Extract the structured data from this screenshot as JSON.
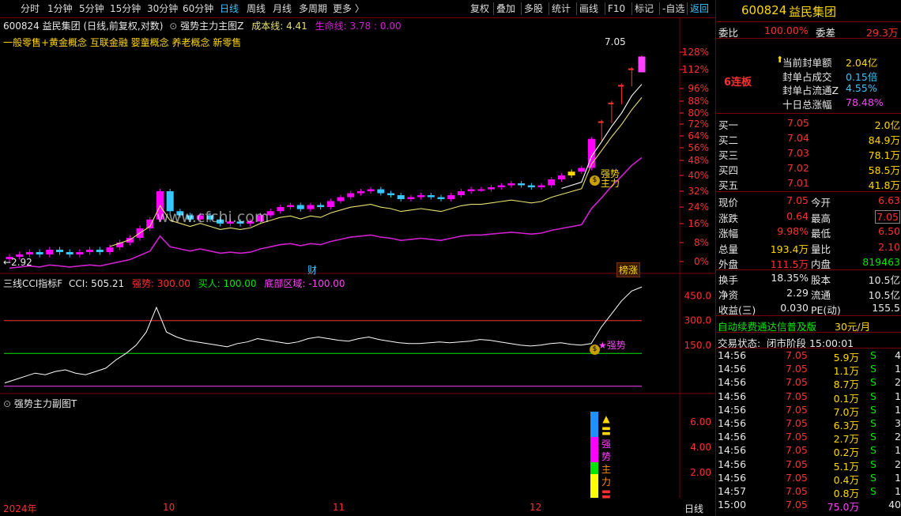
{
  "toolbar": {
    "left": [
      {
        "label": "分时",
        "active": false
      },
      {
        "label": "1分钟",
        "active": false
      },
      {
        "label": "5分钟",
        "active": false
      },
      {
        "label": "15分钟",
        "active": false
      },
      {
        "label": "30分钟",
        "active": false
      },
      {
        "label": "60分钟",
        "active": false
      },
      {
        "label": "日线",
        "active": true
      },
      {
        "label": "周线",
        "active": false
      },
      {
        "label": "月线",
        "active": false
      },
      {
        "label": "多周期",
        "active": false
      },
      {
        "label": "更多 〉",
        "active": false
      }
    ],
    "right": [
      {
        "label": "复权",
        "active": false
      },
      {
        "label": "叠加",
        "active": false
      },
      {
        "label": "多股",
        "active": false
      },
      {
        "label": "统计",
        "active": false
      },
      {
        "label": "画线",
        "active": false
      },
      {
        "label": "F10",
        "active": false
      },
      {
        "label": "标记",
        "active": false
      },
      {
        "label": "-自选",
        "active": false
      },
      {
        "label": "返回",
        "active": true
      }
    ]
  },
  "main_chart": {
    "stock_line": "600824 益民集团 (日线,前复权,对数)",
    "indicator_name": "强势主力主图Z",
    "cost_line": "成本线: 4.41",
    "life_line": "生命线: 3.78 : 0.00",
    "concepts": "一般零售+黄金概念 互联金融 婴童概念 养老概念 新零售",
    "high_label": "7.05",
    "low_label": "←2.92",
    "tag_cai": "财",
    "tag_bangzhang": "榜涨",
    "signal_line1": "强势",
    "signal_line2": "主力",
    "watermark": "www.cfchi.com"
  },
  "chart_data": [
    {
      "type": "candlestick",
      "title": "600824 益民集团 (日线,前复权,对数)",
      "yscale": "log",
      "y_ticks": [
        "128%",
        "112%",
        "96%",
        "88%",
        "80%",
        "72%",
        "64%",
        "56%",
        "48%",
        "40%",
        "32%",
        "24%",
        "16%",
        "8%",
        "0%"
      ],
      "low_label": "2.92",
      "high_label": "7.05",
      "series": [
        {
          "name": "成本线",
          "color": "#e8e070",
          "last": 4.41
        },
        {
          "name": "生命线",
          "color": "#d020d0",
          "last": 3.78
        }
      ],
      "approx_closes_pct": [
        2,
        3,
        4,
        3,
        5,
        4,
        3,
        4,
        5,
        4,
        6,
        8,
        10,
        14,
        18,
        32,
        22,
        20,
        18,
        20,
        18,
        16,
        17,
        16,
        17,
        20,
        22,
        24,
        25,
        23,
        25,
        24,
        27,
        29,
        31,
        32,
        33,
        31,
        30,
        28,
        29,
        30,
        29,
        28,
        30,
        32,
        33,
        33,
        34,
        35,
        36,
        35,
        34,
        35,
        38,
        40,
        42,
        44,
        62,
        74,
        87,
        99,
        113,
        124
      ],
      "dates": [
        "2024年",
        "10",
        "11",
        "12"
      ]
    },
    {
      "type": "line",
      "title": "三线CCI指标F",
      "legend": [
        {
          "label": "CCI: 505.21",
          "color": "#ffffff"
        },
        {
          "label": "强势: 300.00",
          "color": "#ff3030"
        },
        {
          "label": "买人: 100.00",
          "color": "#00e600"
        },
        {
          "label": "底部区域: -100.00",
          "color": "#ff40ff"
        }
      ],
      "y_ticks": [
        "450.0",
        "300.0",
        "150.0"
      ],
      "reference_lines": [
        300,
        100,
        -100
      ],
      "cci_values": [
        -80,
        -60,
        -40,
        -20,
        -30,
        -10,
        0,
        -20,
        -30,
        -10,
        10,
        60,
        100,
        150,
        230,
        380,
        230,
        200,
        180,
        170,
        160,
        150,
        140,
        160,
        170,
        190,
        180,
        170,
        160,
        170,
        190,
        200,
        190,
        180,
        175,
        190,
        200,
        185,
        175,
        165,
        160,
        160,
        165,
        170,
        165,
        170,
        175,
        185,
        180,
        170,
        160,
        150,
        145,
        150,
        160,
        165,
        155,
        150,
        160,
        260,
        340,
        420,
        480,
        505
      ]
    },
    {
      "type": "bar",
      "title": "强势主力副图T",
      "y_ticks": [
        "6.00",
        "4.00",
        "2.00"
      ],
      "legend_vertical": [
        "▲",
        "〓",
        "强",
        "势",
        "主",
        "力",
        "〓"
      ]
    }
  ],
  "cci_panel": {
    "title": "三线CCI指标F",
    "cci_value": "CCI: 505.21",
    "strong": "强势: 300.00",
    "buy": "买人: 100.00",
    "bottom": "底部区域: -100.00",
    "signal": "★强势"
  },
  "sub_panel": {
    "title": "强势主力副图T",
    "vlabels": [
      "▲",
      "〓",
      "强",
      "势",
      "主",
      "力",
      "〓"
    ]
  },
  "date_axis": {
    "labels": [
      "2024年",
      "10",
      "11",
      "12"
    ],
    "period": "日线"
  },
  "quote": {
    "code": "600824",
    "name": "益民集团",
    "webi_label": "委比",
    "webi_value": "100.00%",
    "weicha_label": "委差",
    "weicha_value": "29.3万",
    "board": "6连板",
    "seal": [
      {
        "label": "当前封单额",
        "value": "2.04亿",
        "color": "yellow",
        "arrow": "⬆"
      },
      {
        "label": "封单占成交",
        "value": "0.15倍",
        "color": "cyan",
        "arrow": ""
      },
      {
        "label": "封单占流通Z",
        "value": "4.55%",
        "color": "cyan",
        "arrow": ""
      },
      {
        "label": "十日总涨幅",
        "value": "78.48%",
        "color": "magenta",
        "arrow": ""
      }
    ],
    "book": [
      {
        "label": "买一",
        "price": "7.05",
        "vol": "2.0亿"
      },
      {
        "label": "买二",
        "price": "7.04",
        "vol": "84.9万"
      },
      {
        "label": "买三",
        "price": "7.03",
        "vol": "78.1万"
      },
      {
        "label": "买四",
        "price": "7.02",
        "vol": "58.5万"
      },
      {
        "label": "买五",
        "price": "7.01",
        "vol": "41.8万"
      }
    ],
    "stats": [
      {
        "l1": "现价",
        "v1": "7.05",
        "c1": "red",
        "l2": "今开",
        "v2": "6.63",
        "c2": "red"
      },
      {
        "l1": "涨跌",
        "v1": "0.64",
        "c1": "red",
        "l2": "最高",
        "v2": "7.05",
        "c2": "red"
      },
      {
        "l1": "涨幅",
        "v1": "9.98%",
        "c1": "red",
        "l2": "最低",
        "v2": "6.50",
        "c2": "red"
      },
      {
        "l1": "总量",
        "v1": "193.4万",
        "c1": "yellow",
        "l2": "量比",
        "v2": "2.10",
        "c2": "red"
      },
      {
        "l1": "外盘",
        "v1": "111.5万",
        "c1": "red",
        "l2": "内盘",
        "v2": "819463",
        "c2": "green"
      }
    ],
    "fund": [
      {
        "l1": "换手",
        "v1": "18.35%",
        "l2": "股本",
        "v2": "10.5亿"
      },
      {
        "l1": "净资",
        "v1": "2.29",
        "l2": "流通",
        "v2": "10.5亿"
      },
      {
        "l1": "收益(三)",
        "v1": "0.030",
        "l2": "PE(动)",
        "v2": "155.5"
      }
    ],
    "ad_text": "自动续费通达信普及版",
    "ad_price": "30元/月",
    "status_label": "交易状态:",
    "status_value": "闭市阶段 15:00:01",
    "ticks": [
      {
        "t": "14:56",
        "p": "7.05",
        "v": "5.9万",
        "s": "S",
        "n": "4"
      },
      {
        "t": "14:56",
        "p": "7.05",
        "v": "1.1万",
        "s": "S",
        "n": "1"
      },
      {
        "t": "14:56",
        "p": "7.05",
        "v": "8.7万",
        "s": "S",
        "n": "2"
      },
      {
        "t": "14:56",
        "p": "7.05",
        "v": "0.1万",
        "s": "S",
        "n": "1"
      },
      {
        "t": "14:56",
        "p": "7.05",
        "v": "7.0万",
        "s": "S",
        "n": "1"
      },
      {
        "t": "14:56",
        "p": "7.05",
        "v": "6.3万",
        "s": "S",
        "n": "3"
      },
      {
        "t": "14:56",
        "p": "7.05",
        "v": "2.7万",
        "s": "S",
        "n": "2"
      },
      {
        "t": "14:56",
        "p": "7.05",
        "v": "0.2万",
        "s": "S",
        "n": "1"
      },
      {
        "t": "14:56",
        "p": "7.05",
        "v": "5.1万",
        "s": "S",
        "n": "2"
      },
      {
        "t": "14:56",
        "p": "7.05",
        "v": "0.4万",
        "s": "S",
        "n": "1"
      },
      {
        "t": "14:57",
        "p": "7.05",
        "v": "0.8万",
        "s": "S",
        "n": "1"
      },
      {
        "t": "15:00",
        "p": "7.05",
        "v": "75.0万",
        "s": "",
        "n": "40"
      }
    ]
  },
  "colors": {
    "up": "#ff3030",
    "down": "#37c6ff",
    "magenta": "#ff00ff",
    "cost": "#e8e070",
    "life": "#d020d0",
    "grid_red": "#7a0000"
  }
}
